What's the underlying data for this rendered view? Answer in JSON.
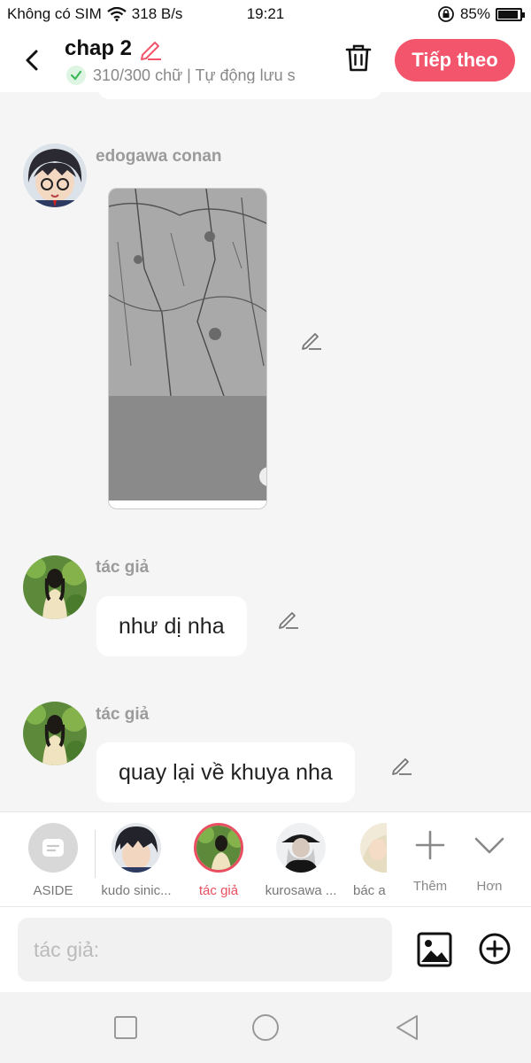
{
  "status_bar": {
    "carrier": "Không có SIM",
    "speed": "318 B/s",
    "time": "19:21",
    "battery": "85%",
    "battery_level": 0.85,
    "icons": [
      "wifi-icon",
      "rotation-lock-icon",
      "battery-icon"
    ]
  },
  "header": {
    "title": "chap 2",
    "subtitle": "310/300 chữ | Tự động lưu s",
    "next_label": "Tiếp theo",
    "accent": "#f2556c"
  },
  "messages": [
    {
      "author": "edogawa conan",
      "type": "image"
    },
    {
      "author": "tác giả",
      "text": "như dị nha"
    },
    {
      "author": "tác giả",
      "text": "quay lại về khuya nha"
    }
  ],
  "characters": [
    {
      "label": "ASIDE"
    },
    {
      "label": "kudo sinic..."
    },
    {
      "label": "tác giả",
      "active": true
    },
    {
      "label": "kurosawa ..."
    },
    {
      "label": "bác a"
    }
  ],
  "controls": {
    "add_label": "Thêm",
    "more_label": "Hơn"
  },
  "input": {
    "placeholder": "tác giả:"
  },
  "colors": {
    "accent": "#f2556c",
    "active_char": "#e84e5f",
    "check_green": "#3cb95a"
  }
}
